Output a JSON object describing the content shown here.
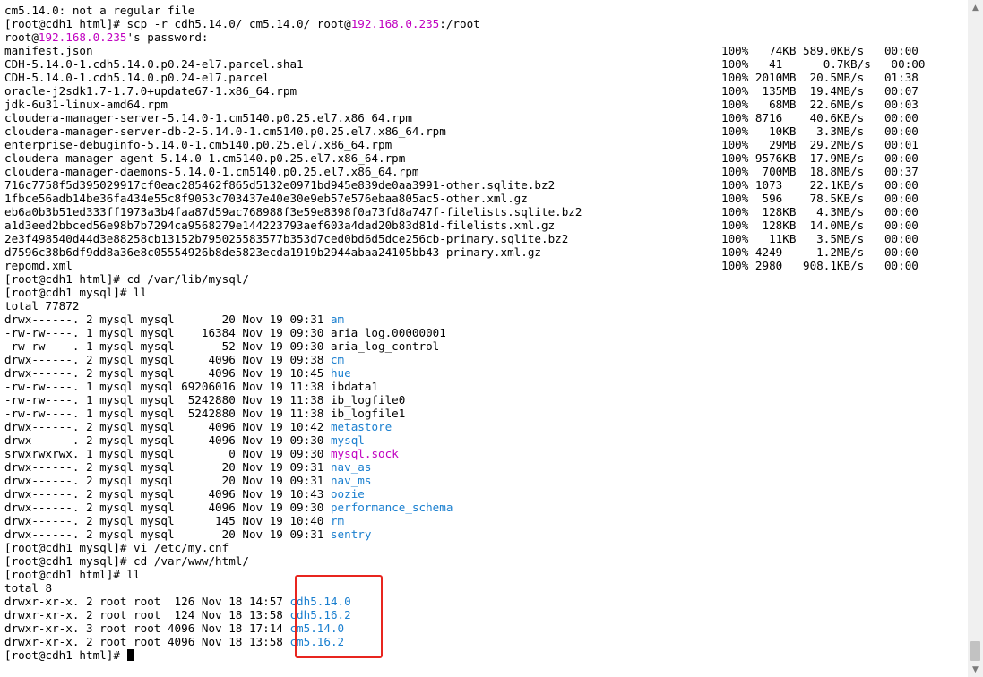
{
  "terminal": {
    "lines": [
      {
        "segs": [
          {
            "text": "cm5.14.0: not a regular file"
          }
        ]
      },
      {
        "segs": [
          {
            "text": "[root@cdh1 html]# scp -r cdh5.14.0/ cm5.14.0/ root@"
          },
          {
            "text": "192.168.0.235",
            "cls": "ip"
          },
          {
            "text": ":/root"
          }
        ]
      },
      {
        "segs": [
          {
            "text": "root@"
          },
          {
            "text": "192.168.0.235",
            "cls": "ip"
          },
          {
            "text": "'s password:"
          }
        ]
      },
      {
        "segs": [
          {
            "text": "manifest.json"
          }
        ],
        "stat": "100%   74KB 589.0KB/s   00:00"
      },
      {
        "segs": [
          {
            "text": "CDH-5.14.0-1.cdh5.14.0.p0.24-el7.parcel.sha1"
          }
        ],
        "stat": "100%   41      0.7KB/s   00:00"
      },
      {
        "segs": [
          {
            "text": "CDH-5.14.0-1.cdh5.14.0.p0.24-el7.parcel"
          }
        ],
        "stat": "100% 2010MB  20.5MB/s   01:38"
      },
      {
        "segs": [
          {
            "text": "oracle-j2sdk1.7-1.7.0+update67-1.x86_64.rpm"
          }
        ],
        "stat": "100%  135MB  19.4MB/s   00:07"
      },
      {
        "segs": [
          {
            "text": "jdk-6u31-linux-amd64.rpm"
          }
        ],
        "stat": "100%   68MB  22.6MB/s   00:03"
      },
      {
        "segs": [
          {
            "text": "cloudera-manager-server-5.14.0-1.cm5140.p0.25.el7.x86_64.rpm"
          }
        ],
        "stat": "100% 8716    40.6KB/s   00:00"
      },
      {
        "segs": [
          {
            "text": "cloudera-manager-server-db-2-5.14.0-1.cm5140.p0.25.el7.x86_64.rpm"
          }
        ],
        "stat": "100%   10KB   3.3MB/s   00:00"
      },
      {
        "segs": [
          {
            "text": "enterprise-debuginfo-5.14.0-1.cm5140.p0.25.el7.x86_64.rpm"
          }
        ],
        "stat": "100%   29MB  29.2MB/s   00:01"
      },
      {
        "segs": [
          {
            "text": "cloudera-manager-agent-5.14.0-1.cm5140.p0.25.el7.x86_64.rpm"
          }
        ],
        "stat": "100% 9576KB  17.9MB/s   00:00"
      },
      {
        "segs": [
          {
            "text": "cloudera-manager-daemons-5.14.0-1.cm5140.p0.25.el7.x86_64.rpm"
          }
        ],
        "stat": "100%  700MB  18.8MB/s   00:37"
      },
      {
        "segs": [
          {
            "text": "716c7758f5d395029917cf0eac285462f865d5132e0971bd945e839de0aa3991-other.sqlite.bz2"
          }
        ],
        "stat": "100% 1073    22.1KB/s   00:00"
      },
      {
        "segs": [
          {
            "text": "1fbce56adb14be36fa434e55c8f9053c703437e40e30e9eb57e576ebaa805ac5-other.xml.gz"
          }
        ],
        "stat": "100%  596    78.5KB/s   00:00"
      },
      {
        "segs": [
          {
            "text": "eb6a0b3b51ed333ff1973a3b4faa87d59ac768988f3e59e8398f0a73fd8a747f-filelists.sqlite.bz2"
          }
        ],
        "stat": "100%  128KB   4.3MB/s   00:00"
      },
      {
        "segs": [
          {
            "text": "a1d3eed2bbced56e98b7b7294ca9568279e144223793aef603a4dad20b83d81d-filelists.xml.gz"
          }
        ],
        "stat": "100%  128KB  14.0MB/s   00:00"
      },
      {
        "segs": [
          {
            "text": "2e3f498540d44d3e88258cb13152b795025583577b353d7ced0bd6d5dce256cb-primary.sqlite.bz2"
          }
        ],
        "stat": "100%   11KB   3.5MB/s   00:00"
      },
      {
        "segs": [
          {
            "text": "d7596c38b6df9dd8a36e8c05554926b8de5823ecda1919b2944abaa24105bb43-primary.xml.gz"
          }
        ],
        "stat": "100% 4249     1.2MB/s   00:00"
      },
      {
        "segs": [
          {
            "text": "repomd.xml"
          }
        ],
        "stat": "100% 2980   908.1KB/s   00:00"
      },
      {
        "segs": [
          {
            "text": "[root@cdh1 html]# cd /var/lib/mysql/"
          }
        ]
      },
      {
        "segs": [
          {
            "text": "[root@cdh1 mysql]# ll"
          }
        ]
      },
      {
        "segs": [
          {
            "text": "total 77872"
          }
        ]
      },
      {
        "segs": [
          {
            "text": "drwx------. 2 mysql mysql       20 Nov 19 09:31 "
          },
          {
            "text": "am",
            "cls": "dir"
          }
        ]
      },
      {
        "segs": [
          {
            "text": "-rw-rw----. 1 mysql mysql    16384 Nov 19 09:30 aria_log.00000001"
          }
        ]
      },
      {
        "segs": [
          {
            "text": "-rw-rw----. 1 mysql mysql       52 Nov 19 09:30 aria_log_control"
          }
        ]
      },
      {
        "segs": [
          {
            "text": "drwx------. 2 mysql mysql     4096 Nov 19 09:38 "
          },
          {
            "text": "cm",
            "cls": "dir"
          }
        ]
      },
      {
        "segs": [
          {
            "text": "drwx------. 2 mysql mysql     4096 Nov 19 10:45 "
          },
          {
            "text": "hue",
            "cls": "dir"
          }
        ]
      },
      {
        "segs": [
          {
            "text": "-rw-rw----. 1 mysql mysql 69206016 Nov 19 11:38 ibdata1"
          }
        ]
      },
      {
        "segs": [
          {
            "text": "-rw-rw----. 1 mysql mysql  5242880 Nov 19 11:38 ib_logfile0"
          }
        ]
      },
      {
        "segs": [
          {
            "text": "-rw-rw----. 1 mysql mysql  5242880 Nov 19 11:38 ib_logfile1"
          }
        ]
      },
      {
        "segs": [
          {
            "text": "drwx------. 2 mysql mysql     4096 Nov 19 10:42 "
          },
          {
            "text": "metastore",
            "cls": "dir"
          }
        ]
      },
      {
        "segs": [
          {
            "text": "drwx------. 2 mysql mysql     4096 Nov 19 09:30 "
          },
          {
            "text": "mysql",
            "cls": "dir"
          }
        ]
      },
      {
        "segs": [
          {
            "text": "srwxrwxrwx. 1 mysql mysql        0 Nov 19 09:30 "
          },
          {
            "text": "mysql.sock",
            "cls": "sock"
          }
        ]
      },
      {
        "segs": [
          {
            "text": "drwx------. 2 mysql mysql       20 Nov 19 09:31 "
          },
          {
            "text": "nav_as",
            "cls": "dir"
          }
        ]
      },
      {
        "segs": [
          {
            "text": "drwx------. 2 mysql mysql       20 Nov 19 09:31 "
          },
          {
            "text": "nav_ms",
            "cls": "dir"
          }
        ]
      },
      {
        "segs": [
          {
            "text": "drwx------. 2 mysql mysql     4096 Nov 19 10:43 "
          },
          {
            "text": "oozie",
            "cls": "dir"
          }
        ]
      },
      {
        "segs": [
          {
            "text": "drwx------. 2 mysql mysql     4096 Nov 19 09:30 "
          },
          {
            "text": "performance_schema",
            "cls": "dir"
          }
        ]
      },
      {
        "segs": [
          {
            "text": "drwx------. 2 mysql mysql      145 Nov 19 10:40 "
          },
          {
            "text": "rm",
            "cls": "dir"
          }
        ]
      },
      {
        "segs": [
          {
            "text": "drwx------. 2 mysql mysql       20 Nov 19 09:31 "
          },
          {
            "text": "sentry",
            "cls": "dir"
          }
        ]
      },
      {
        "segs": [
          {
            "text": "[root@cdh1 mysql]# vi /etc/my.cnf"
          }
        ]
      },
      {
        "segs": [
          {
            "text": "[root@cdh1 mysql]# cd /var/www/html/"
          }
        ]
      },
      {
        "segs": [
          {
            "text": "[root@cdh1 html]# ll"
          }
        ]
      },
      {
        "segs": [
          {
            "text": "total 8"
          }
        ]
      },
      {
        "segs": [
          {
            "text": "drwxr-xr-x. 2 root root  126 Nov 18 14:57 "
          },
          {
            "text": "cdh5.14.0",
            "cls": "dir"
          }
        ]
      },
      {
        "segs": [
          {
            "text": "drwxr-xr-x. 2 root root  124 Nov 18 13:58 "
          },
          {
            "text": "cdh5.16.2",
            "cls": "dir"
          }
        ]
      },
      {
        "segs": [
          {
            "text": "drwxr-xr-x. 3 root root 4096 Nov 18 17:14 "
          },
          {
            "text": "cm5.14.0",
            "cls": "dir"
          }
        ]
      },
      {
        "segs": [
          {
            "text": "drwxr-xr-x. 2 root root 4096 Nov 18 13:58 "
          },
          {
            "text": "cm5.16.2",
            "cls": "dir"
          }
        ]
      },
      {
        "segs": [
          {
            "text": "[root@cdh1 html]# "
          }
        ],
        "cursor": true
      }
    ]
  },
  "scrollbar": {
    "up_icon": "▲",
    "down_icon": "▼"
  },
  "colors": {
    "ip": "#c000c0",
    "directory": "#1a7fcf",
    "socket": "#c000c0",
    "highlight_box": "#e8251f"
  }
}
